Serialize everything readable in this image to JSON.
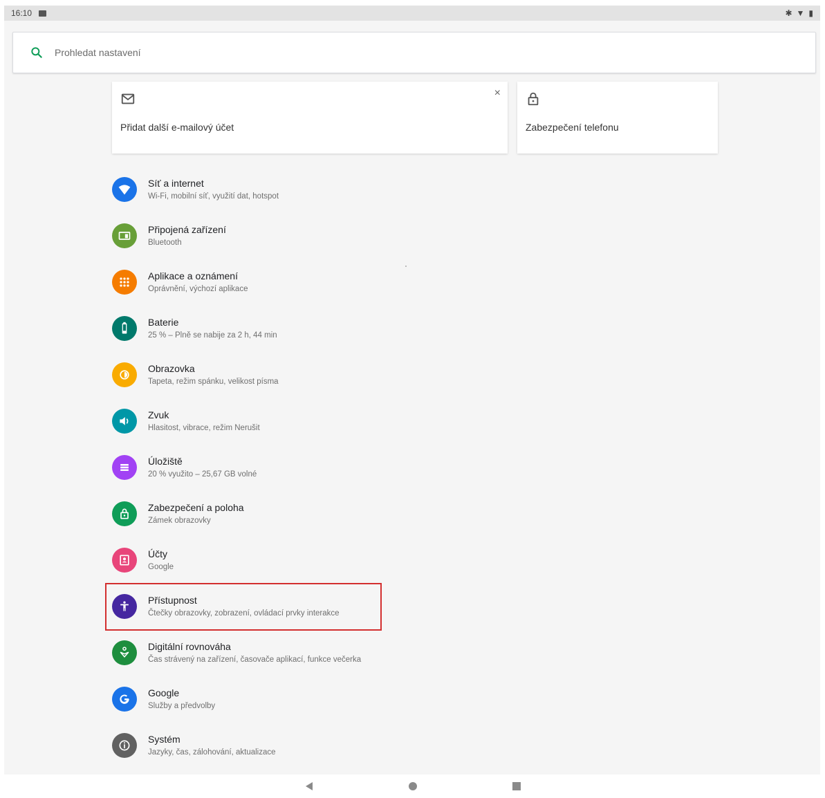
{
  "statusbar": {
    "time": "16:10",
    "icons": [
      "bluetooth-icon",
      "wifi-icon",
      "battery-icon"
    ]
  },
  "search": {
    "placeholder": "Prohledat nastavení"
  },
  "suggestions": [
    {
      "icon": "email-icon",
      "label": "Přidat další e-mailový účet",
      "dismiss": "×"
    },
    {
      "icon": "lock-icon",
      "label": "Zabezpečení telefonu"
    }
  ],
  "settings": [
    {
      "title": "Síť a internet",
      "subtitle": "Wi-Fi, mobilní síť, využití dat, hotspot",
      "color": "#1a73e8",
      "icon": "wifi-icon"
    },
    {
      "title": "Připojená zařízení",
      "subtitle": "Bluetooth",
      "color": "#689f38",
      "icon": "devices-icon"
    },
    {
      "title": "Aplikace a oznámení",
      "subtitle": "Oprávnění, výchozí aplikace",
      "color": "#f57c00",
      "icon": "apps-icon"
    },
    {
      "title": "Baterie",
      "subtitle": "25 % – Plně se nabije za 2 h, 44 min",
      "color": "#00796b",
      "icon": "battery-icon"
    },
    {
      "title": "Obrazovka",
      "subtitle": "Tapeta, režim spánku, velikost písma",
      "color": "#f9ab00",
      "icon": "brightness-icon"
    },
    {
      "title": "Zvuk",
      "subtitle": "Hlasitost, vibrace, režim Nerušit",
      "color": "#0097a7",
      "icon": "volume-icon"
    },
    {
      "title": "Úložiště",
      "subtitle": "20 % využito – 25,67 GB volné",
      "color": "#a142f4",
      "icon": "storage-icon"
    },
    {
      "title": "Zabezpečení a poloha",
      "subtitle": "Zámek obrazovky",
      "color": "#0f9d58",
      "icon": "lock-icon"
    },
    {
      "title": "Účty",
      "subtitle": "Google",
      "color": "#e8457a",
      "icon": "account-icon"
    },
    {
      "title": "Přístupnost",
      "subtitle": "Čtečky obrazovky, zobrazení, ovládací prvky interakce",
      "color": "#4527a0",
      "icon": "accessibility-icon"
    },
    {
      "title": "Digitální rovnováha",
      "subtitle": "Čas strávený na zařízení, časovače aplikací, funkce večerka",
      "color": "#1e8e3e",
      "icon": "wellbeing-icon"
    },
    {
      "title": "Google",
      "subtitle": "Služby a předvolby",
      "color": "#1a73e8",
      "icon": "google-icon"
    },
    {
      "title": "Systém",
      "subtitle": "Jazyky, čas, zálohování, aktualizace",
      "color": "#616161",
      "icon": "info-icon"
    }
  ],
  "colors": {
    "accent": "#0f9d58",
    "highlight": "#d32f2f"
  },
  "navbar": [
    "back-icon",
    "home-icon",
    "recents-icon"
  ]
}
